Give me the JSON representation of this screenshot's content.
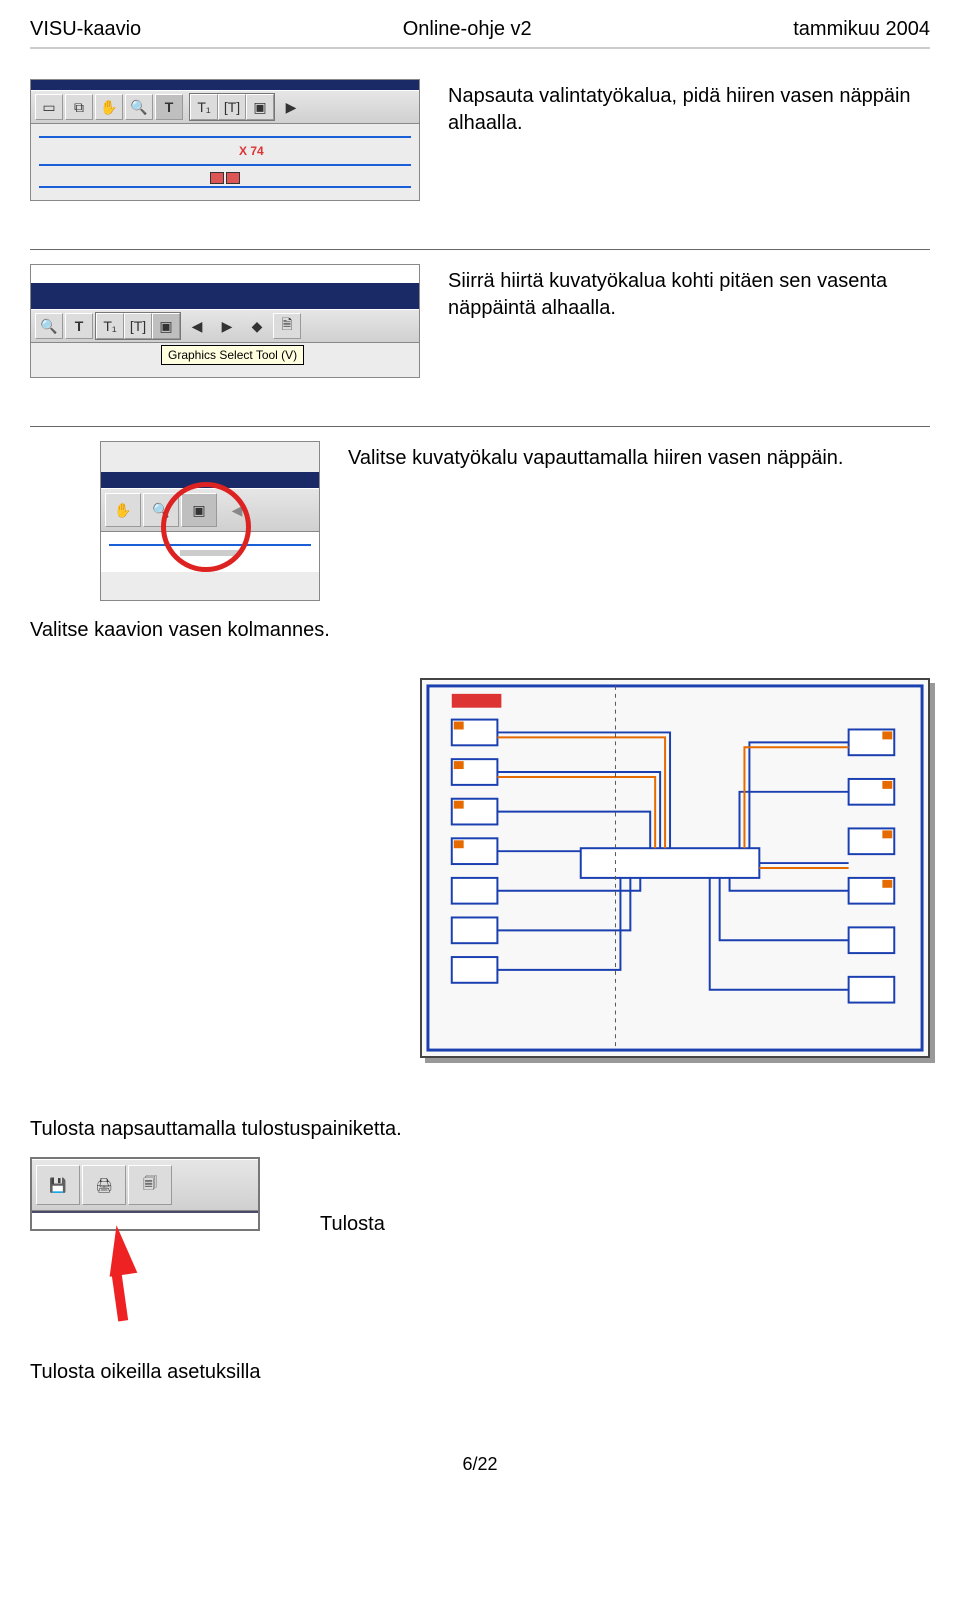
{
  "header": {
    "left": "VISU-kaavio",
    "center": "Online-ohje v2",
    "right": "tammikuu 2004"
  },
  "steps": {
    "s1": "Napsauta valintatyökalua, pidä hiiren vasen näppäin alhaalla.",
    "s2": "Siirrä hiirtä kuvatyökalua kohti pitäen sen vasenta näppäintä alhaalla.",
    "s3": "Valitse kuvatyökalu vapauttamalla hiiren vasen näppäin."
  },
  "tooltip": "Graphics Select Tool (V)",
  "captions": {
    "select_third": "Valitse kaavion vasen kolmannes.",
    "print_click": "Tulosta napsauttamalla tulostuspainiketta.",
    "print": "Tulosta",
    "print_settings": "Tulosta oikeilla asetuksilla"
  },
  "schematic_label": "X 74",
  "page": "6/22"
}
